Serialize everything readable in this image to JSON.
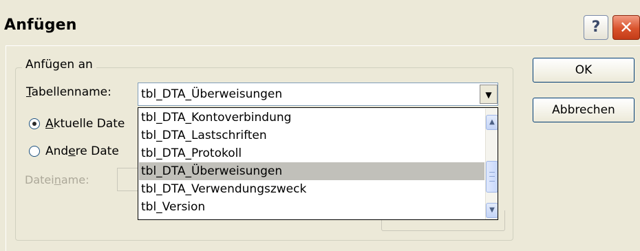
{
  "dialog": {
    "title": "Anfügen",
    "help_glyph": "?",
    "close_glyph": "✕"
  },
  "group": {
    "legend": "Anfügen an",
    "table_label_underlined": "T",
    "table_label_rest": "abellenname:",
    "combo_value": "tbl_DTA_Überweisungen",
    "combo_arrow_glyph": "▼",
    "radio_current": {
      "underlined": "A",
      "rest": "ktuelle Date",
      "checked": true
    },
    "radio_other": {
      "prefix": "And",
      "underlined": "e",
      "rest": "re Date",
      "checked": false
    },
    "file_label": {
      "prefix": "Datei",
      "underlined": "n",
      "rest": "ame:"
    }
  },
  "dropdown": {
    "options": [
      "tbl_DTA_Kontoverbindung",
      "tbl_DTA_Lastschriften",
      "tbl_DTA_Protokoll",
      "tbl_DTA_Überweisungen",
      "tbl_DTA_Verwendungszweck",
      "tbl_Version"
    ],
    "selected_index": 3,
    "scroll_up_glyph": "▲",
    "scroll_down_glyph": "▼"
  },
  "buttons": {
    "ok": "OK",
    "cancel": "Abbrechen"
  },
  "colors": {
    "dialog_bg": "#ece9d8",
    "selection_bg": "#c1c0ba",
    "close_button": "#d9532c"
  }
}
